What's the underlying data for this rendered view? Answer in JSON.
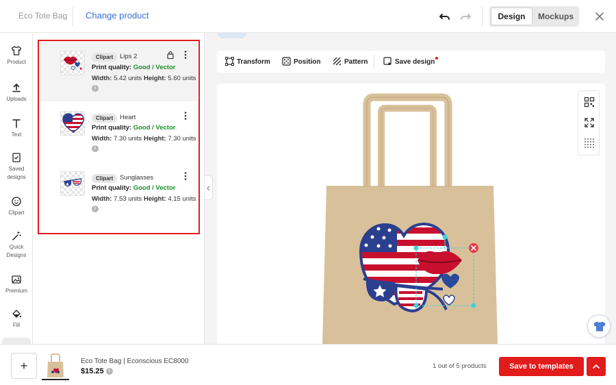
{
  "header": {
    "product_name": "Eco Tote Bag",
    "change_product": "Change product",
    "mode_tabs": [
      "Design",
      "Mockups"
    ],
    "active_mode": "Design"
  },
  "nav": {
    "items": [
      {
        "label": "Product",
        "icon": "tshirt-icon"
      },
      {
        "label": "Uploads",
        "icon": "upload-icon"
      },
      {
        "label": "Text",
        "icon": "text-icon"
      },
      {
        "label": "Saved designs",
        "icon": "saved-designs-icon"
      },
      {
        "label": "Clipart",
        "icon": "smiley-icon"
      },
      {
        "label": "Quick Designs",
        "icon": "magic-wand-icon"
      },
      {
        "label": "Premium",
        "icon": "premium-image-icon"
      },
      {
        "label": "Fill",
        "icon": "paint-bucket-icon"
      }
    ]
  },
  "layers": [
    {
      "badge": "Clipart",
      "name": "Lips 2",
      "quality_label": "Print quality:",
      "quality_value": "Good / Vector",
      "width_label": "Width:",
      "width_value": "5.42 units",
      "height_label": "Height:",
      "height_value": "5.60",
      "units_tail": "units",
      "locked": true
    },
    {
      "badge": "Clipart",
      "name": "Heart",
      "quality_label": "Print quality:",
      "quality_value": "Good / Vector",
      "width_label": "Width:",
      "width_value": "7.30 units",
      "height_label": "Height:",
      "height_value": "7.30",
      "units_tail": "units"
    },
    {
      "badge": "Clipart",
      "name": "Sunglasses",
      "quality_label": "Print quality:",
      "quality_value": "Good / Vector",
      "width_label": "Width:",
      "width_value": "7.53 units",
      "height_label": "Height:",
      "height_value": "4.15 units",
      "units_tail": ""
    }
  ],
  "toolbar": {
    "transform": "Transform",
    "position": "Position",
    "pattern": "Pattern",
    "save_design": "Save design"
  },
  "footer": {
    "product_title": "Eco Tote Bag | Econscious EC8000",
    "price": "$15.25",
    "count": "1 out of 5 products",
    "save_templates": "Save to templates"
  },
  "colors": {
    "accent_red": "#e21b1b",
    "link_blue": "#3b6fd6",
    "quality_green": "#1a8f2a",
    "tote": "#d8c09a"
  }
}
